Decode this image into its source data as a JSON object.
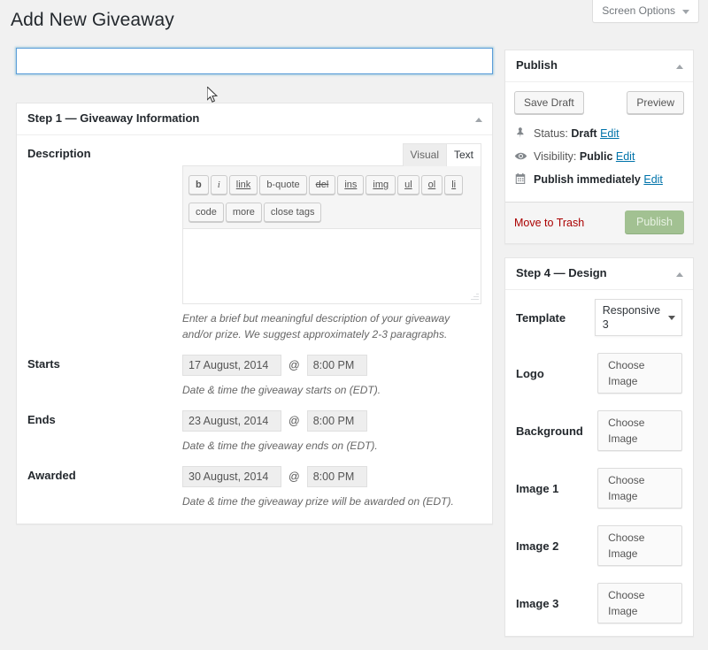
{
  "screen_options": {
    "label": "Screen Options",
    "caret_icon": "chevron-down-icon"
  },
  "page": {
    "title": "Add New Giveaway"
  },
  "title_field": {
    "value": "",
    "placeholder": ""
  },
  "step1": {
    "header": "Step 1 — Giveaway Information",
    "description": {
      "label": "Description",
      "tabs": [
        {
          "label": "Visual",
          "active": false
        },
        {
          "label": "Text",
          "active": true
        }
      ],
      "quicktags_row1": [
        "b",
        "i",
        "link",
        "b-quote",
        "del",
        "ins",
        "img",
        "ul",
        "ol",
        "li"
      ],
      "quicktags_row2": [
        "code",
        "more",
        "close tags"
      ],
      "content": "",
      "help": "Enter a brief but meaningful description of your giveaway and/or prize. We suggest approximately 2-3 paragraphs."
    },
    "starts": {
      "label": "Starts",
      "date": "17 August, 2014",
      "separator": "@",
      "time": "8:00 PM",
      "help": "Date & time the giveaway starts on (EDT)."
    },
    "ends": {
      "label": "Ends",
      "date": "23 August, 2014",
      "separator": "@",
      "time": "8:00 PM",
      "help": "Date & time the giveaway ends on (EDT)."
    },
    "awarded": {
      "label": "Awarded",
      "date": "30 August, 2014",
      "separator": "@",
      "time": "8:00 PM",
      "help": "Date & time the giveaway prize will be awarded on (EDT)."
    }
  },
  "publish_box": {
    "header": "Publish",
    "save_draft": "Save Draft",
    "preview": "Preview",
    "status": {
      "icon": "pin-icon",
      "prefix": "Status:",
      "value": "Draft",
      "edit": "Edit"
    },
    "visibility": {
      "icon": "eye-icon",
      "prefix": "Visibility:",
      "value": "Public",
      "edit": "Edit"
    },
    "schedule": {
      "icon": "calendar-icon",
      "text": "Publish immediately",
      "edit": "Edit"
    },
    "trash": "Move to Trash",
    "publish": "Publish",
    "publish_color": "#a2c192"
  },
  "design_box": {
    "header": "Step 4 — Design",
    "template": {
      "label": "Template",
      "value": "Responsive 3"
    },
    "rows": [
      {
        "label": "Logo",
        "button": "Choose Image"
      },
      {
        "label": "Background",
        "button": "Choose Image"
      },
      {
        "label": "Image 1",
        "button": "Choose Image"
      },
      {
        "label": "Image 2",
        "button": "Choose Image"
      },
      {
        "label": "Image 3",
        "button": "Choose Image"
      }
    ]
  },
  "theme": {
    "page_bg": "#f1f1f1",
    "box_bg": "#ffffff",
    "border": "#e5e5e5",
    "link": "#0073aa",
    "trash": "#a00000",
    "focus_border": "#5b9dd9"
  }
}
